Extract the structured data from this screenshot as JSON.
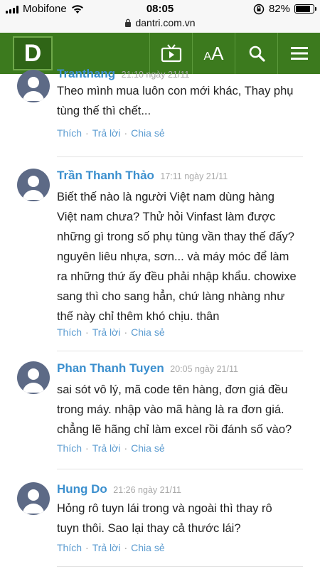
{
  "status_bar": {
    "carrier": "Mobifone",
    "time": "08:05",
    "battery": "82%",
    "battery_level": 0.82,
    "url": "dantri.com.vn"
  },
  "header": {
    "logo_text": "D",
    "font_small": "A",
    "font_big": "A",
    "accent_color": "#3c7a1e"
  },
  "comments": [
    {
      "name": "Tranthang",
      "time": "21:10 ngày 21/11",
      "text_lines": [
        "Theo mình mua luôn con mới khác, Thay phụ",
        "tùng thế thì chết..."
      ],
      "like": "Thích",
      "reply": "Trả lời",
      "share": "Chia sẻ"
    },
    {
      "name": "Trần Thanh Thảo",
      "time": "17:11 ngày 21/11",
      "text_lines": [
        "Biết thế nào là người Việt nam dùng hàng",
        "Việt nam chưa? Thử hỏi Vinfast làm được",
        "những gì trong số phụ tùng vần thay thế đấy?",
        "nguyên liêu nhựa, sơn... và máy móc để làm",
        "ra những thứ ấy đều phải nhập khẩu. chowixe",
        "sang thì cho sang hẳn, chứ làng nhàng như",
        "thế này chỉ thêm khó chịu. thân"
      ],
      "like": "Thích",
      "reply": "Trả lời",
      "share": "Chia sẻ"
    },
    {
      "name": "Phan Thanh Tuyen",
      "time": "20:05 ngày 21/11",
      "text_lines": [
        "sai sót vô lý, mã code tên hàng, đơn giá đều",
        "trong máy. nhập vào mã hàng là ra đơn giá.",
        "chẳng lẽ hãng chỉ làm excel rồi đánh số vào?"
      ],
      "like": "Thích",
      "reply": "Trả lời",
      "share": "Chia sẻ"
    },
    {
      "name": "Hung Do",
      "time": "21:26 ngày 21/11",
      "text_lines": [
        "Hỏng rô tuyn lái trong và ngoài thì thay rô",
        "tuyn thôi. Sao lại thay cả thước lái?"
      ],
      "like": "Thích",
      "reply": "Trả lời",
      "share": "Chia sẻ"
    }
  ]
}
